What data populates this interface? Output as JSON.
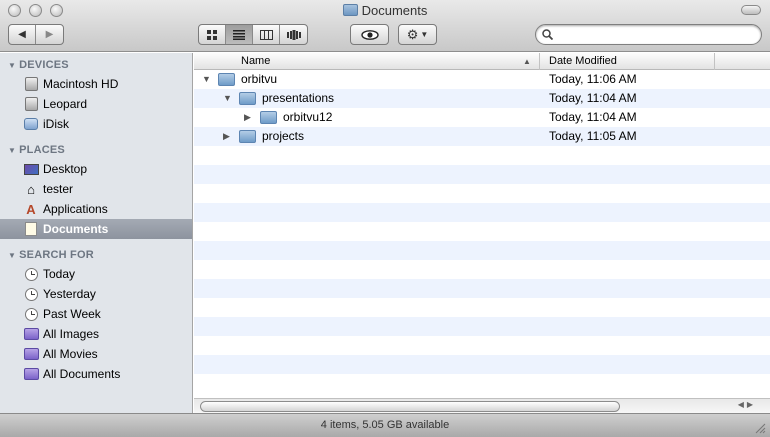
{
  "window": {
    "title": "Documents"
  },
  "toolbar": {
    "back_icon": "back-arrow-icon",
    "forward_icon": "forward-arrow-icon",
    "view_buttons": [
      "icon-view",
      "list-view",
      "column-view",
      "coverflow-view"
    ],
    "active_view": "list-view",
    "quicklook_icon": "eye-icon",
    "action_icon": "gear-icon",
    "search_placeholder": ""
  },
  "sidebar": {
    "sections": [
      {
        "title": "DEVICES",
        "items": [
          {
            "label": "Macintosh HD",
            "icon": "hard-disk-icon"
          },
          {
            "label": "Leopard",
            "icon": "hard-disk-icon"
          },
          {
            "label": "iDisk",
            "icon": "idisk-icon"
          }
        ]
      },
      {
        "title": "PLACES",
        "items": [
          {
            "label": "Desktop",
            "icon": "desktop-icon"
          },
          {
            "label": "tester",
            "icon": "home-icon"
          },
          {
            "label": "Applications",
            "icon": "applications-icon"
          },
          {
            "label": "Documents",
            "icon": "documents-icon",
            "selected": true
          }
        ]
      },
      {
        "title": "SEARCH FOR",
        "items": [
          {
            "label": "Today",
            "icon": "clock-icon"
          },
          {
            "label": "Yesterday",
            "icon": "clock-icon"
          },
          {
            "label": "Past Week",
            "icon": "clock-icon"
          },
          {
            "label": "All Images",
            "icon": "smart-folder-icon"
          },
          {
            "label": "All Movies",
            "icon": "smart-folder-icon"
          },
          {
            "label": "All Documents",
            "icon": "smart-folder-icon"
          }
        ]
      }
    ]
  },
  "list": {
    "columns": [
      "Name",
      "Date Modified"
    ],
    "rows": [
      {
        "name": "orbitvu",
        "date": "Today, 11:06 AM",
        "expanded": true
      },
      {
        "name": "presentations",
        "date": "Today, 11:04 AM",
        "expanded": true
      },
      {
        "name": "orbitvu12",
        "date": "Today, 11:04 AM",
        "expanded": false
      },
      {
        "name": "projects",
        "date": "Today, 11:05 AM",
        "expanded": false
      }
    ]
  },
  "status": {
    "text": "4 items, 5.05 GB available"
  },
  "colors": {
    "sidebar_bg": "#e1e5ea",
    "selection": "#9ba1ab",
    "row_alt": "#edf3fe",
    "folder": "#8fb3d9"
  }
}
